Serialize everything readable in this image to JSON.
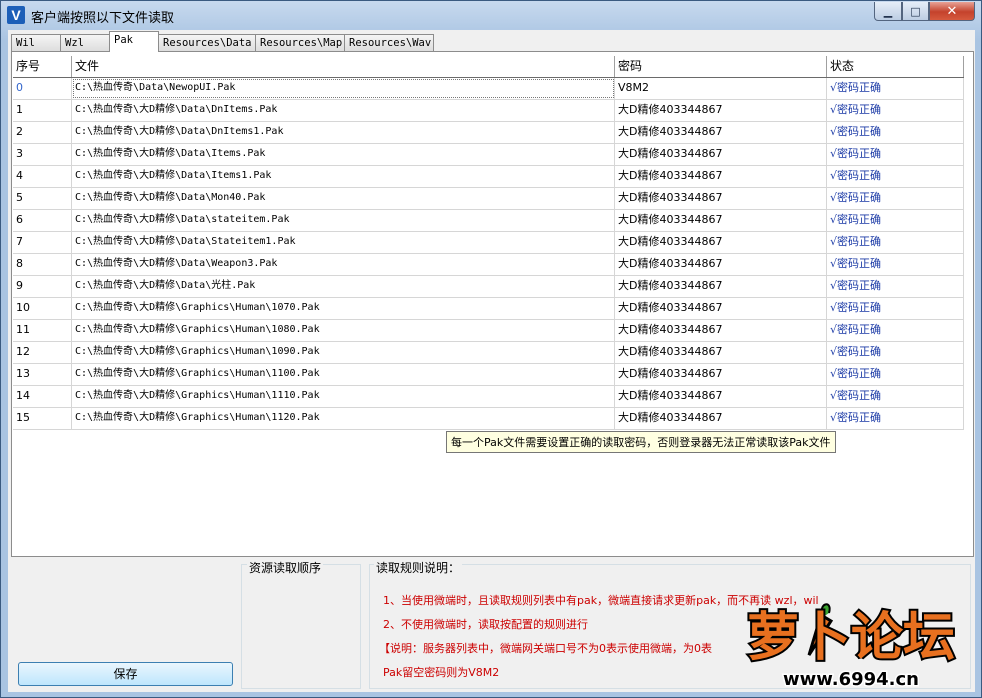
{
  "window": {
    "title": "客户端按照以下文件读取",
    "icon_letter": "V"
  },
  "tabs": [
    "Wil",
    "Wzl",
    "Pak",
    "Resources\\Data",
    "Resources\\Map",
    "Resources\\Wav"
  ],
  "table": {
    "headers": [
      "序号",
      "文件",
      "密码",
      "状态"
    ],
    "rows": [
      {
        "index": "0",
        "file": "C:\\热血传奇\\Data\\NewopUI.Pak",
        "password": "V8M2",
        "status": "√密码正确"
      },
      {
        "index": "1",
        "file": "C:\\热血传奇\\大D精修\\Data\\DnItems.Pak",
        "password": "大D精修403344867",
        "status": "√密码正确"
      },
      {
        "index": "2",
        "file": "C:\\热血传奇\\大D精修\\Data\\DnItems1.Pak",
        "password": "大D精修403344867",
        "status": "√密码正确"
      },
      {
        "index": "3",
        "file": "C:\\热血传奇\\大D精修\\Data\\Items.Pak",
        "password": "大D精修403344867",
        "status": "√密码正确"
      },
      {
        "index": "4",
        "file": "C:\\热血传奇\\大D精修\\Data\\Items1.Pak",
        "password": "大D精修403344867",
        "status": "√密码正确"
      },
      {
        "index": "5",
        "file": "C:\\热血传奇\\大D精修\\Data\\Mon40.Pak",
        "password": "大D精修403344867",
        "status": "√密码正确"
      },
      {
        "index": "6",
        "file": "C:\\热血传奇\\大D精修\\Data\\stateitem.Pak",
        "password": "大D精修403344867",
        "status": "√密码正确"
      },
      {
        "index": "7",
        "file": "C:\\热血传奇\\大D精修\\Data\\Stateitem1.Pak",
        "password": "大D精修403344867",
        "status": "√密码正确"
      },
      {
        "index": "8",
        "file": "C:\\热血传奇\\大D精修\\Data\\Weapon3.Pak",
        "password": "大D精修403344867",
        "status": "√密码正确"
      },
      {
        "index": "9",
        "file": "C:\\热血传奇\\大D精修\\Data\\光柱.Pak",
        "password": "大D精修403344867",
        "status": "√密码正确"
      },
      {
        "index": "10",
        "file": "C:\\热血传奇\\大D精修\\Graphics\\Human\\1070.Pak",
        "password": "大D精修403344867",
        "status": "√密码正确"
      },
      {
        "index": "11",
        "file": "C:\\热血传奇\\大D精修\\Graphics\\Human\\1080.Pak",
        "password": "大D精修403344867",
        "status": "√密码正确"
      },
      {
        "index": "12",
        "file": "C:\\热血传奇\\大D精修\\Graphics\\Human\\1090.Pak",
        "password": "大D精修403344867",
        "status": "√密码正确"
      },
      {
        "index": "13",
        "file": "C:\\热血传奇\\大D精修\\Graphics\\Human\\1100.Pak",
        "password": "大D精修403344867",
        "status": "√密码正确"
      },
      {
        "index": "14",
        "file": "C:\\热血传奇\\大D精修\\Graphics\\Human\\1110.Pak",
        "password": "大D精修403344867",
        "status": "√密码正确"
      },
      {
        "index": "15",
        "file": "C:\\热血传奇\\大D精修\\Graphics\\Human\\1120.Pak",
        "password": "大D精修403344867",
        "status": "√密码正确"
      }
    ]
  },
  "tooltip": "每一个Pak文件需要设置正确的读取密码，否则登录器无法正常读取该Pak文件",
  "bottom": {
    "save_label": "保存",
    "order_title": "资源读取顺序",
    "rules_title": "读取规则说明：",
    "rules": [
      "1、当使用微端时，且读取规则列表中有pak，微端直接请求更新pak，而不再读 wzl，wil",
      "2、不使用微端时，读取按配置的规则进行",
      "【说明：服务器列表中，微端网关端口号不为0表示使用微端，为0表",
      "Pak留空密码则为V8M2"
    ]
  },
  "watermark": {
    "text": "萝卜论坛",
    "url": "www.6994.cn"
  }
}
